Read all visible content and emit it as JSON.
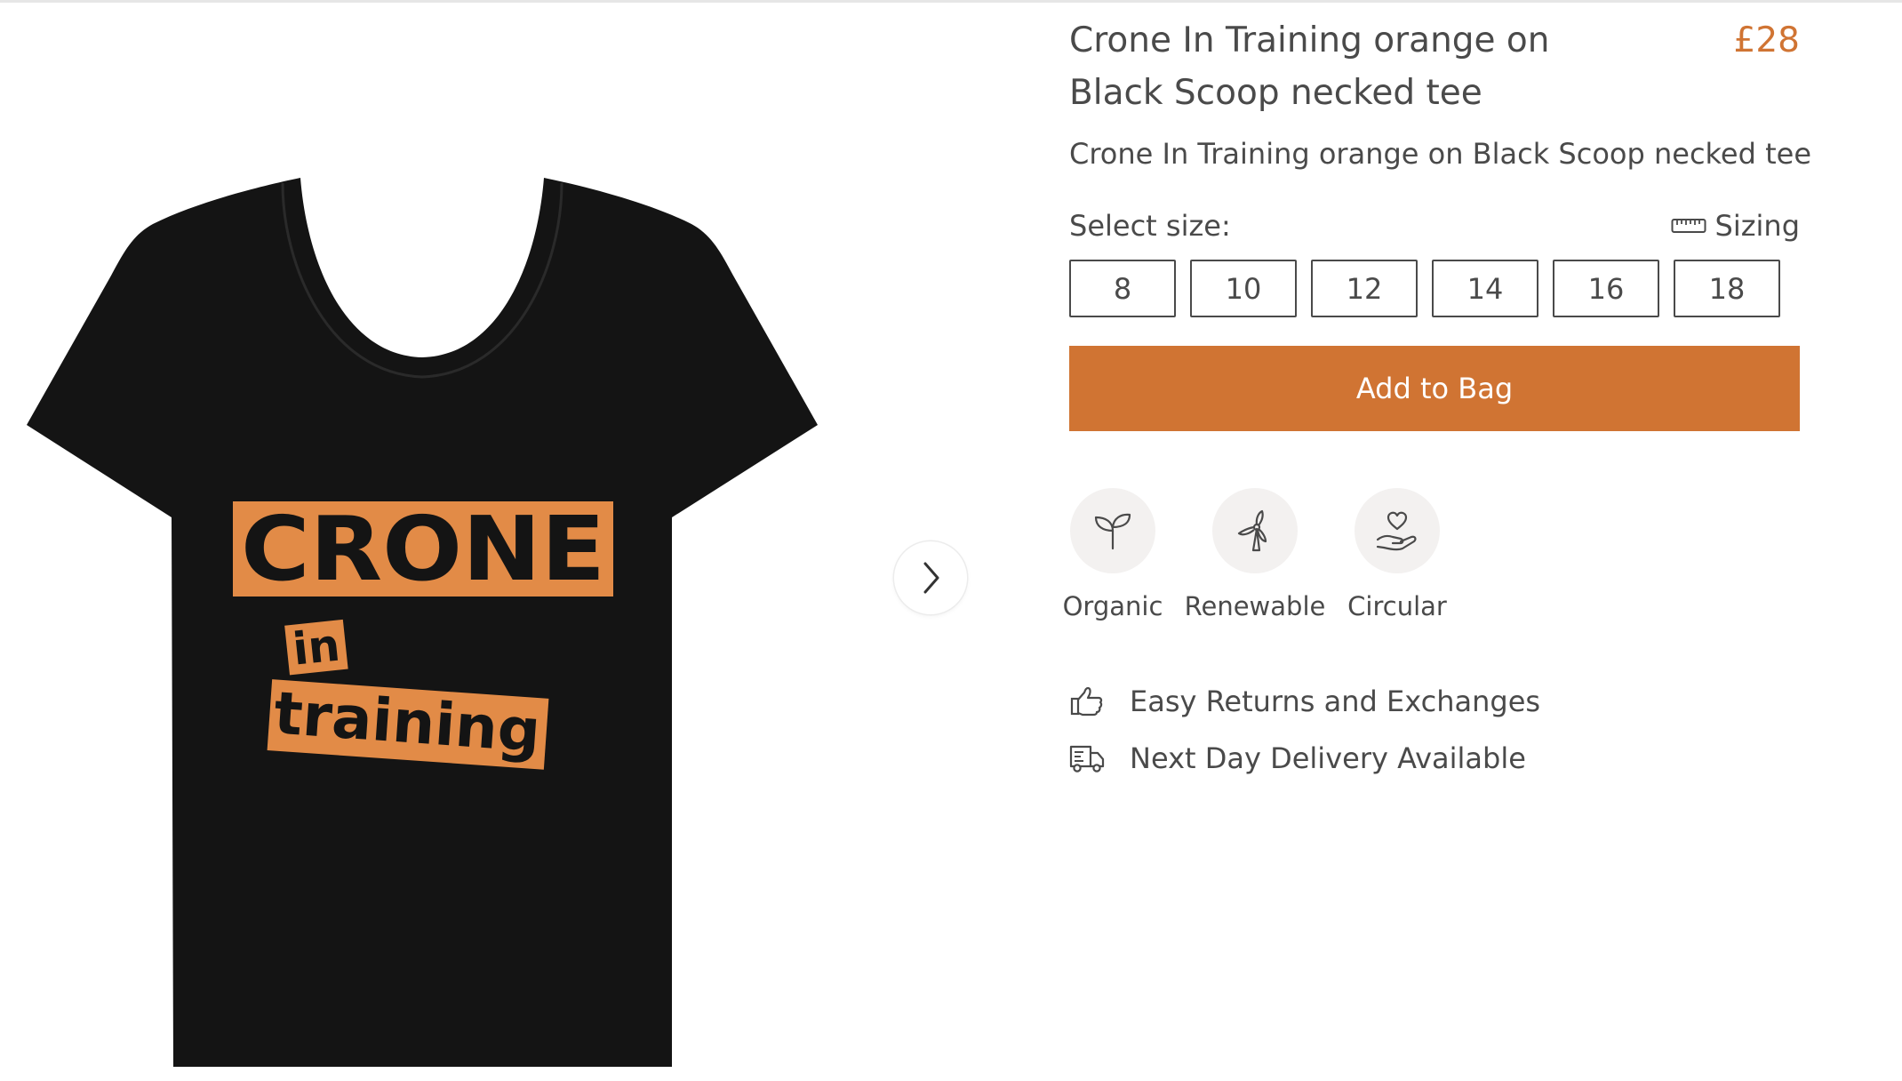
{
  "product": {
    "title": "Crone In Training orange on Black Scoop necked tee",
    "price": "£28",
    "subtitle": "Crone In Training orange on Black Scoop necked tee",
    "image_alt": "Black scoop necked t-shirt with orange Crone in training print",
    "print": {
      "line1": "CRONE",
      "line2": "in",
      "line3": "training"
    }
  },
  "size_selector": {
    "label": "Select size:",
    "sizing_link": "Sizing",
    "sizes": [
      "8",
      "10",
      "12",
      "14",
      "16",
      "18"
    ]
  },
  "actions": {
    "add_to_bag": "Add to Bag"
  },
  "attributes": [
    {
      "label": "Organic",
      "icon": "sprout-icon"
    },
    {
      "label": "Renewable",
      "icon": "wind-turbine-icon"
    },
    {
      "label": "Circular",
      "icon": "heart-hand-icon"
    }
  ],
  "perks": [
    {
      "label": "Easy Returns and Exchanges",
      "icon": "thumbs-up-icon"
    },
    {
      "label": "Next Day Delivery Available",
      "icon": "delivery-truck-icon"
    }
  ],
  "colors": {
    "accent": "#d07433",
    "text": "#4a4a4a",
    "tee": "#141414",
    "print": "#e28b47",
    "icon_circle": "#f3f1f0"
  }
}
